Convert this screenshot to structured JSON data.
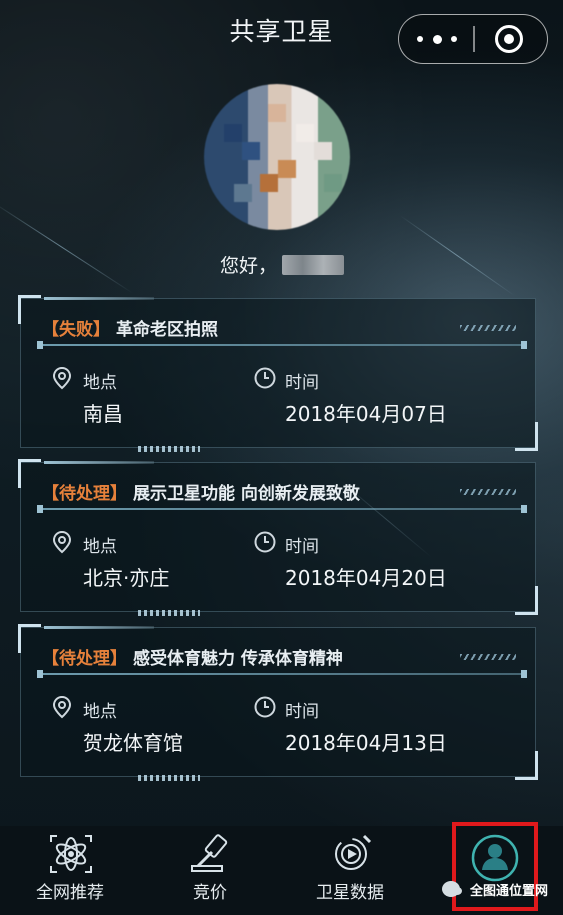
{
  "header": {
    "title": "共享卫星",
    "more_icon": "more-dots-icon",
    "close_icon": "capsule-close-icon"
  },
  "profile": {
    "greeting": "您好，"
  },
  "tasks": [
    {
      "status": "【失败】",
      "name": "革命老区拍照",
      "location_label": "地点",
      "location": "南昌",
      "time_label": "时间",
      "time": "2018年04月07日"
    },
    {
      "status": "【待处理】",
      "name": "展示卫星功能 向创新发展致敬",
      "location_label": "地点",
      "location": "北京·亦庄",
      "time_label": "时间",
      "time": "2018年04月20日"
    },
    {
      "status": "【待处理】",
      "name": "感受体育魅力 传承体育精神",
      "location_label": "地点",
      "location": "贺龙体育馆",
      "time_label": "时间",
      "time": "2018年04月13日"
    }
  ],
  "tabbar": {
    "items": [
      {
        "label": "全网推荐",
        "icon": "atom-icon"
      },
      {
        "label": "竞价",
        "icon": "gavel-icon"
      },
      {
        "label": "卫星数据",
        "icon": "satellite-play-icon"
      },
      {
        "label": "",
        "icon": "user-icon"
      }
    ]
  },
  "watermark": {
    "text": "全图通位置网"
  },
  "colors": {
    "status_orange": "#e6813b",
    "highlight_red": "#e0191c",
    "frame_cyan": "#9ec3d4"
  }
}
